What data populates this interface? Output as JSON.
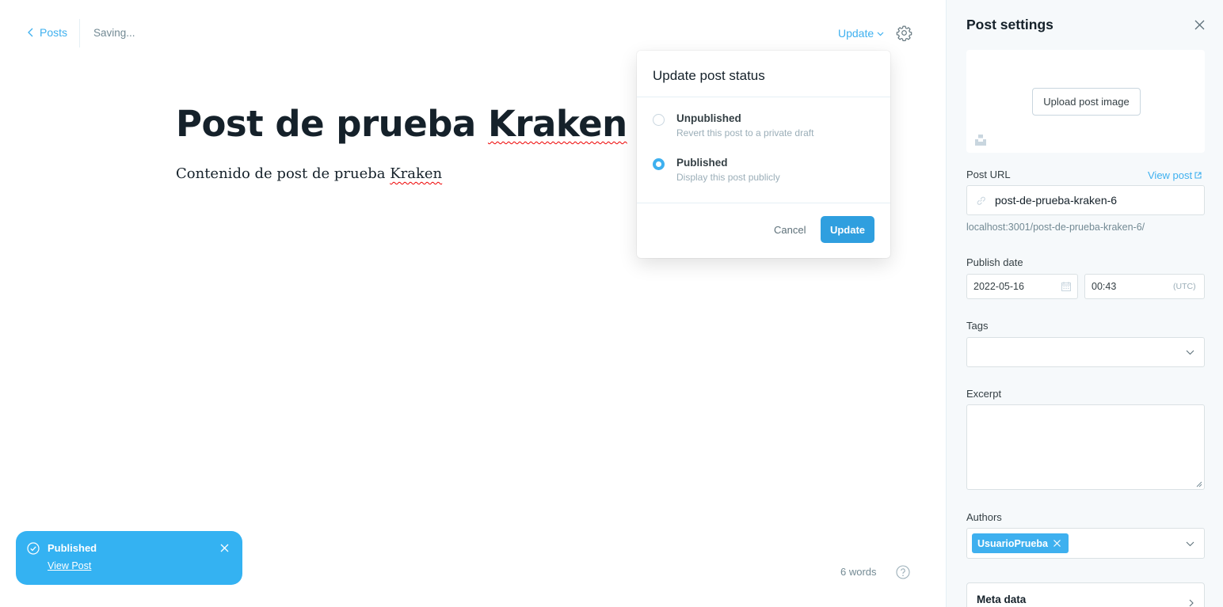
{
  "topbar": {
    "back_label": "Posts",
    "status": "Saving...",
    "publish_trigger": "Update"
  },
  "editor": {
    "title_part1": "Post de prueba ",
    "title_misspelled": "Kraken",
    "body_part1": "Contenido de post de prueba ",
    "body_misspelled": "Kraken",
    "word_count": "6 words"
  },
  "publish_menu": {
    "heading": "Update post status",
    "options": [
      {
        "label": "Unpublished",
        "description": "Revert this post to a private draft",
        "selected": false
      },
      {
        "label": "Published",
        "description": "Display this post publicly",
        "selected": true
      }
    ],
    "cancel_label": "Cancel",
    "confirm_label": "Update"
  },
  "notification": {
    "title": "Published",
    "link": "View Post"
  },
  "settings": {
    "title": "Post settings",
    "upload_image": "Upload post image",
    "url_label": "Post URL",
    "view_post": "View post",
    "slug": "post-de-prueba-kraken-6",
    "url_preview": "localhost:3001/post-de-prueba-kraken-6/",
    "publish_date_label": "Publish date",
    "date": "2022-05-16",
    "time": "00:43",
    "timezone": "(UTC)",
    "tags_label": "Tags",
    "excerpt_label": "Excerpt",
    "authors_label": "Authors",
    "author": "UsuarioPrueba",
    "meta_data": "Meta data"
  },
  "colors": {
    "accent": "#3eb0ef",
    "button_blue": "#2f9fdf",
    "toast": "#34b2f2",
    "text": "#15212a",
    "muted": "#738a94",
    "panel_bg": "#f6f9fb"
  }
}
